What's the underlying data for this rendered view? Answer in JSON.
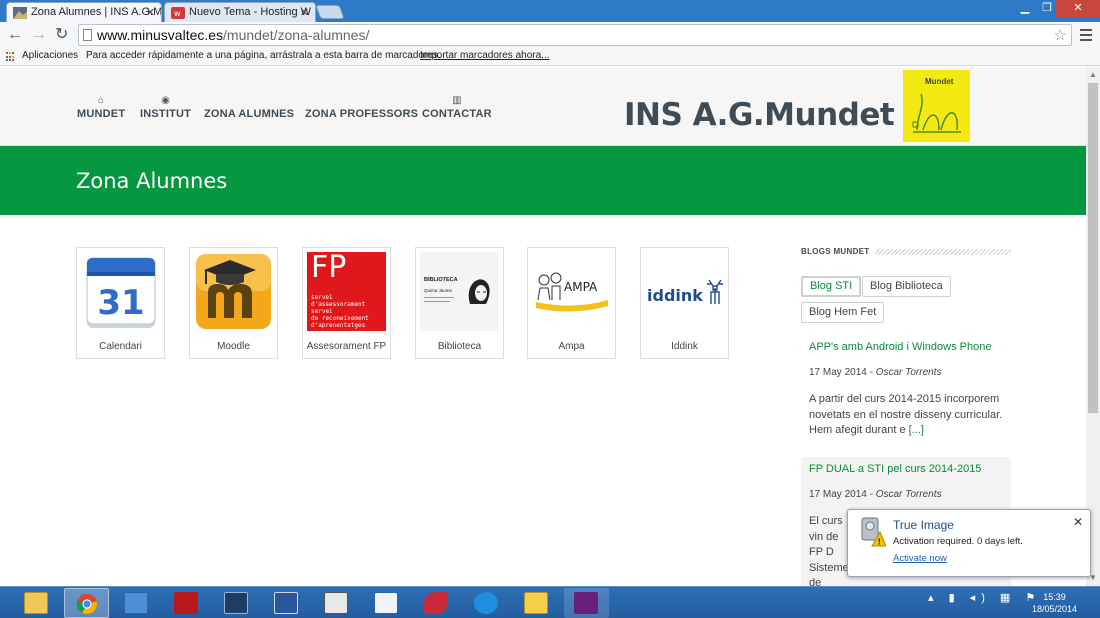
{
  "browser": {
    "tabs": [
      {
        "label": "Zona Alumnes | INS A.G.M",
        "active": true
      },
      {
        "label": "Nuevo Tema - Hosting W",
        "active": false
      }
    ],
    "url_host": "www.minusvaltec.es",
    "url_path": "/mundet/zona-alumnes/",
    "bookmarks": {
      "apps_label": "Aplicaciones",
      "hint": "Para acceder rápidamente a una página, arrástrala a esta barra de marcadores.",
      "import_link": "Importar marcadores ahora..."
    }
  },
  "site": {
    "menu": [
      {
        "label": "MUNDET",
        "icon": "home-icon",
        "glyph": "⌂"
      },
      {
        "label": "INSTITUT",
        "icon": "eye-icon",
        "glyph": "◉"
      },
      {
        "label": "ZONA ALUMNES",
        "icon": "",
        "glyph": ""
      },
      {
        "label": "ZONA PROFESSORS",
        "icon": "",
        "glyph": ""
      },
      {
        "label": "CONTACTAR",
        "icon": "map-icon",
        "glyph": "▥"
      }
    ],
    "title": "INS A.G.Mundet",
    "logo_text": "Mundet",
    "banner_title": "Zona Alumnes",
    "tiles": [
      {
        "caption": "Calendari",
        "icon": "calendar-icon",
        "number": "31"
      },
      {
        "caption": "Moodle",
        "icon": "moodle-icon"
      },
      {
        "caption": "Assesorament FP",
        "icon": "fp-icon",
        "fp": "FP",
        "fp_lines": [
          "servei",
          "d'assessorament",
          "servei",
          "de reconeixement",
          "d'aprenentatges"
        ]
      },
      {
        "caption": "Biblioteca",
        "icon": "library-icon",
        "lib_title": "BIBLIOTECA",
        "lib_sub": "Quima Jaume"
      },
      {
        "caption": "Ampa",
        "icon": "ampa-icon",
        "ampa": "AMPA"
      },
      {
        "caption": "Iddink",
        "icon": "iddink-icon",
        "iddink": "iddink"
      }
    ],
    "sidebar": {
      "heading": "BLOGS MUNDET",
      "buttons": [
        "Blog STI",
        "Blog Biblioteca",
        "Blog Hem Fet"
      ],
      "posts": [
        {
          "title": "APP's amb Android i Windows Phone",
          "date": "17 May 2014 - ",
          "author": "Oscar Torrents",
          "body": "A partir del curs 2014-2015 incorporem novetats en el nostre disseny curricular. Hem afegit durant e ",
          "more": "[...]"
        },
        {
          "title": "FP DUAL a STI pel curs 2014-2015",
          "date": "17 May 2014 - ",
          "author": "Oscar Torrents",
          "body": "El curs vin de FP D Sistemes de Telecomunicacions i In ",
          "more": "[...]"
        }
      ]
    }
  },
  "notification": {
    "title": "True Image",
    "message": "Activation required. 0 days left.",
    "link": "Activate now"
  },
  "taskbar": {
    "time": "15:39",
    "date": "18/05/2014"
  },
  "colors": {
    "banner_green": "#059841",
    "link_green": "#0a8a3c",
    "taskbar_blue": "#2e6fb5",
    "logo_yellow": "#f4ea12"
  }
}
